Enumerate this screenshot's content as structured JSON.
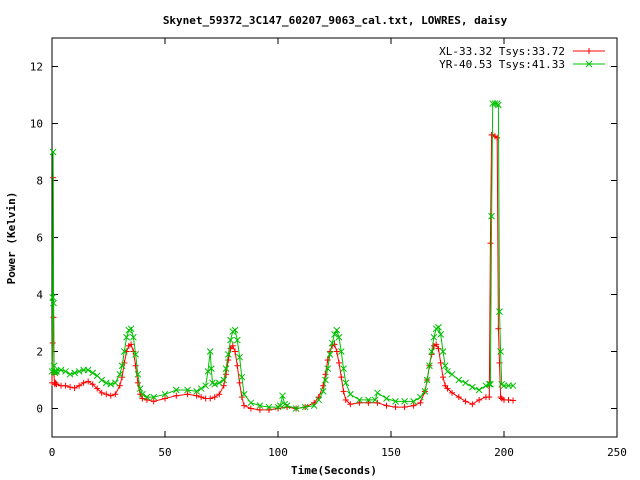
{
  "chart_data": {
    "type": "line",
    "title": "Skynet_59372_3C147_60207_9063_cal.txt, LOWRES, daisy",
    "xlabel": "Time(Seconds)",
    "ylabel": "Power (Kelvin)",
    "xlim": [
      0,
      250
    ],
    "ylim": [
      -1,
      13
    ],
    "xticks": [
      0,
      50,
      100,
      150,
      200,
      250
    ],
    "yticks": [
      0,
      2,
      4,
      6,
      8,
      10,
      12
    ],
    "grid": false,
    "legend_position": "top-right",
    "series": [
      {
        "name": "XL-33.32 Tsys:33.72",
        "color": "#ff0000",
        "marker": "plus",
        "x": [
          0,
          0.3,
          0.5,
          0.7,
          0.9,
          1.1,
          1.3,
          1.6,
          2,
          4,
          6,
          8,
          10,
          12,
          14,
          16,
          18,
          20,
          22,
          24,
          26,
          28,
          30,
          31,
          32,
          33,
          34,
          35,
          36,
          37,
          38,
          39,
          40,
          42,
          45,
          50,
          55,
          60,
          64,
          66,
          68,
          70,
          72,
          74,
          76,
          77,
          78,
          79,
          80,
          81,
          82,
          83,
          84,
          85,
          88,
          92,
          96,
          100,
          104,
          108,
          112,
          116,
          118,
          120,
          121,
          122,
          123,
          124,
          125,
          126,
          127,
          128,
          129,
          130,
          132,
          136,
          140,
          144,
          148,
          152,
          156,
          160,
          163,
          165,
          166,
          167,
          168,
          169,
          170,
          171,
          172,
          173,
          174,
          175,
          177,
          180,
          183,
          186,
          189,
          192,
          193.5,
          194,
          194.5,
          195,
          196,
          197,
          197.5,
          198,
          198.5,
          199,
          200,
          202,
          204
        ],
        "y": [
          0.9,
          2.3,
          8.1,
          3.2,
          1.2,
          0.9,
          0.85,
          0.9,
          0.85,
          0.8,
          0.8,
          0.75,
          0.72,
          0.8,
          0.9,
          0.95,
          0.85,
          0.7,
          0.55,
          0.5,
          0.45,
          0.5,
          0.8,
          1.1,
          1.6,
          2.0,
          2.2,
          2.25,
          2.0,
          1.5,
          0.9,
          0.5,
          0.35,
          0.3,
          0.25,
          0.35,
          0.45,
          0.5,
          0.45,
          0.4,
          0.35,
          0.35,
          0.4,
          0.5,
          0.8,
          1.2,
          1.7,
          2.1,
          2.2,
          2.0,
          1.5,
          0.9,
          0.4,
          0.1,
          0.0,
          -0.05,
          -0.05,
          0.0,
          0.05,
          0.0,
          0.05,
          0.2,
          0.4,
          0.8,
          1.2,
          1.7,
          2.0,
          2.2,
          2.25,
          2.0,
          1.6,
          1.1,
          0.6,
          0.3,
          0.15,
          0.2,
          0.2,
          0.2,
          0.1,
          0.05,
          0.05,
          0.1,
          0.2,
          0.6,
          1.0,
          1.5,
          1.9,
          2.2,
          2.25,
          2.1,
          1.6,
          1.1,
          0.8,
          0.7,
          0.55,
          0.4,
          0.25,
          0.15,
          0.3,
          0.4,
          0.4,
          5.8,
          9.6,
          9.6,
          9.55,
          9.5,
          2.8,
          1.6,
          0.4,
          0.35,
          0.3,
          0.3,
          0.28
        ]
      },
      {
        "name": "YR-40.53 Tsys:41.33",
        "color": "#00c000",
        "marker": "cross",
        "x": [
          0,
          0.3,
          0.5,
          0.7,
          0.9,
          1.1,
          1.3,
          1.6,
          2,
          4,
          6,
          8,
          10,
          12,
          14,
          16,
          18,
          20,
          22,
          24,
          26,
          28,
          30,
          31,
          32,
          33,
          34,
          35,
          36,
          37,
          38,
          39,
          40,
          42,
          45,
          50,
          55,
          60,
          64,
          66,
          68,
          69,
          70,
          70.5,
          71,
          72,
          74,
          76,
          77,
          78,
          79,
          80,
          81,
          82,
          83,
          84,
          85,
          88,
          92,
          96,
          100,
          101,
          102,
          103,
          104,
          108,
          112,
          116,
          118,
          120,
          121,
          122,
          123,
          124,
          125,
          126,
          127,
          128,
          129,
          130,
          132,
          136,
          140,
          143,
          144,
          148,
          152,
          156,
          160,
          163,
          165,
          166,
          167,
          168,
          169,
          170,
          171,
          172,
          173,
          174,
          175,
          177,
          180,
          183,
          186,
          189,
          192,
          193.5,
          194,
          194.5,
          195,
          196,
          197,
          197.5,
          198,
          198.5,
          199,
          200,
          202,
          204
        ],
        "y": [
          1.3,
          3.9,
          9.0,
          3.7,
          1.5,
          1.3,
          1.25,
          1.3,
          1.3,
          1.35,
          1.3,
          1.2,
          1.25,
          1.3,
          1.35,
          1.35,
          1.25,
          1.15,
          1.0,
          0.9,
          0.85,
          0.9,
          1.2,
          1.5,
          2.0,
          2.5,
          2.75,
          2.8,
          2.5,
          1.9,
          1.2,
          0.7,
          0.5,
          0.4,
          0.4,
          0.5,
          0.65,
          0.65,
          0.6,
          0.7,
          0.8,
          1.3,
          2.0,
          1.4,
          0.9,
          0.85,
          0.9,
          1.0,
          1.4,
          1.9,
          2.4,
          2.7,
          2.75,
          2.4,
          1.8,
          1.1,
          0.5,
          0.2,
          0.1,
          0.05,
          0.05,
          0.1,
          0.45,
          0.15,
          0.1,
          0.0,
          0.05,
          0.1,
          0.3,
          0.6,
          1.0,
          1.4,
          1.9,
          2.3,
          2.6,
          2.75,
          2.5,
          2.0,
          1.4,
          0.9,
          0.5,
          0.3,
          0.3,
          0.3,
          0.55,
          0.35,
          0.25,
          0.25,
          0.25,
          0.4,
          0.6,
          1.0,
          1.5,
          2.0,
          2.5,
          2.8,
          2.85,
          2.6,
          2.0,
          1.5,
          1.3,
          1.2,
          1.0,
          0.9,
          0.75,
          0.65,
          0.8,
          0.85,
          0.85,
          6.75,
          10.7,
          10.7,
          10.7,
          10.65,
          3.4,
          2.0,
          0.85,
          0.8,
          0.8,
          0.8
        ]
      }
    ]
  }
}
